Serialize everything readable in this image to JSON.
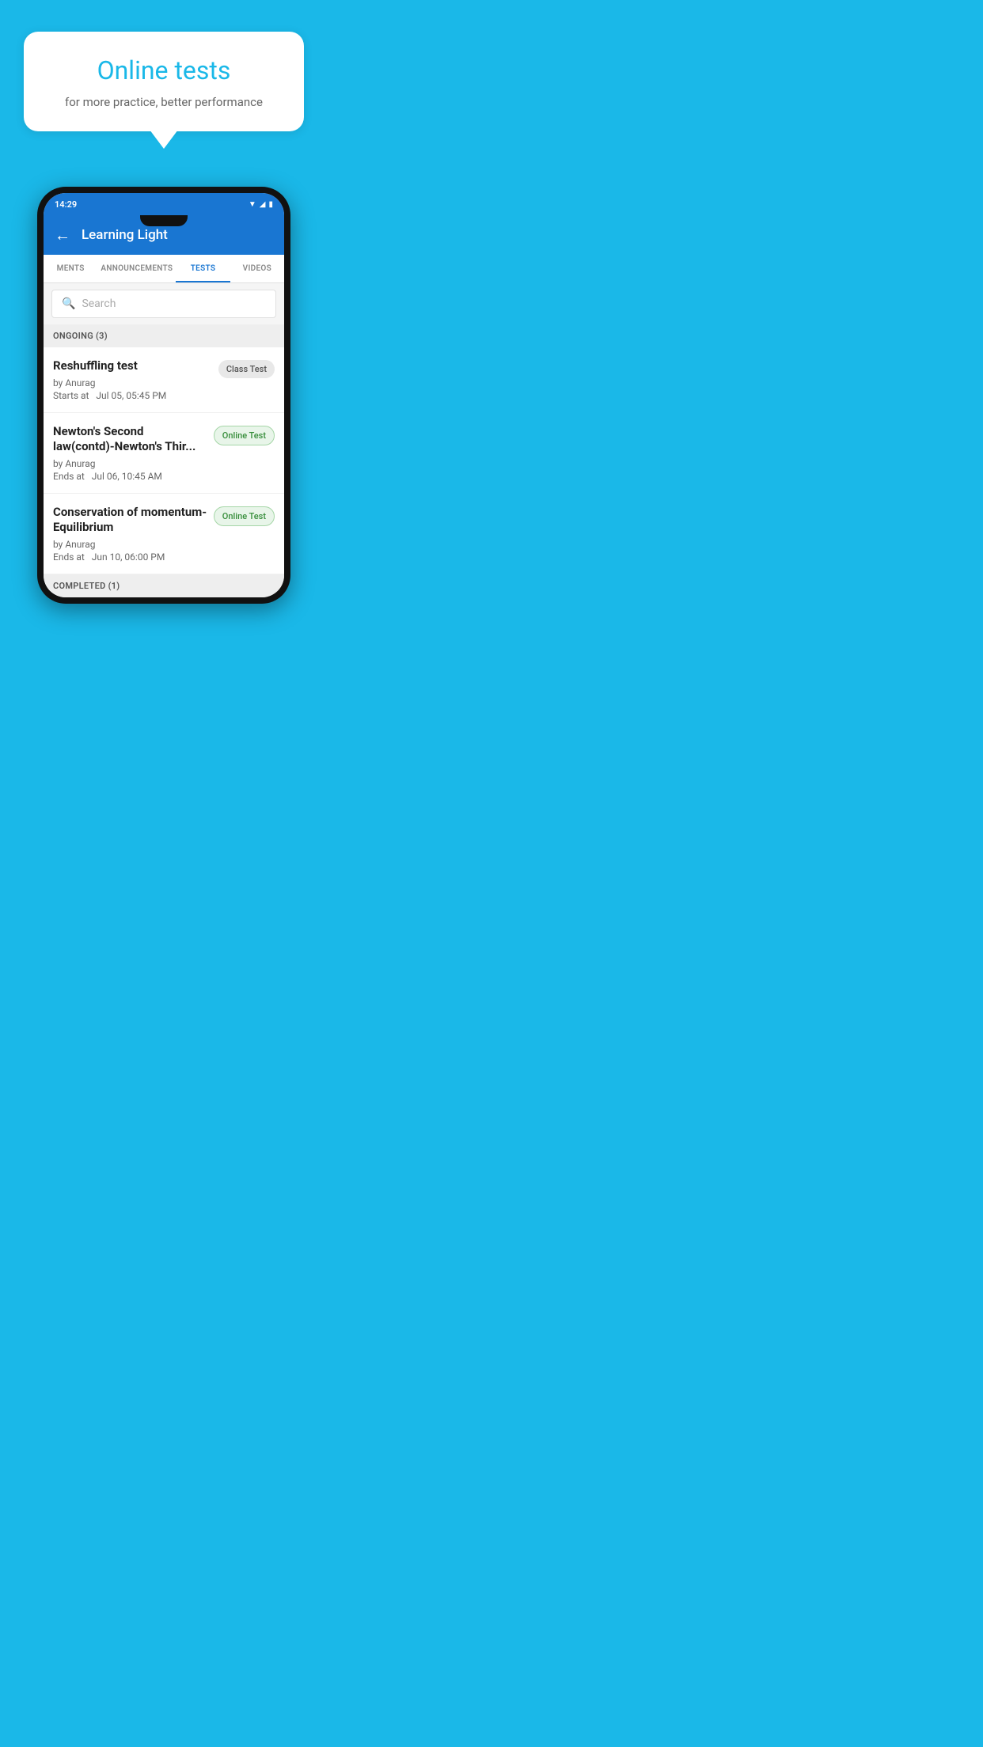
{
  "background_color": "#1ab8e8",
  "hero": {
    "bubble_title": "Online tests",
    "bubble_subtitle": "for more practice, better performance"
  },
  "phone": {
    "status_bar": {
      "time": "14:29",
      "icons": [
        "wifi",
        "signal",
        "battery"
      ]
    },
    "app_bar": {
      "title": "Learning Light",
      "back_label": "←"
    },
    "tabs": [
      {
        "label": "MENTS",
        "active": false
      },
      {
        "label": "ANNOUNCEMENTS",
        "active": false
      },
      {
        "label": "TESTS",
        "active": true
      },
      {
        "label": "VIDEOS",
        "active": false
      }
    ],
    "search": {
      "placeholder": "Search"
    },
    "ongoing_section": {
      "header": "ONGOING (3)",
      "tests": [
        {
          "title": "Reshuffling test",
          "author": "by Anurag",
          "time_label": "Starts at",
          "time": "Jul 05, 05:45 PM",
          "badge": "Class Test",
          "badge_type": "class"
        },
        {
          "title": "Newton's Second law(contd)-Newton's Thir...",
          "author": "by Anurag",
          "time_label": "Ends at",
          "time": "Jul 06, 10:45 AM",
          "badge": "Online Test",
          "badge_type": "online"
        },
        {
          "title": "Conservation of momentum-Equilibrium",
          "author": "by Anurag",
          "time_label": "Ends at",
          "time": "Jun 10, 06:00 PM",
          "badge": "Online Test",
          "badge_type": "online"
        }
      ]
    },
    "completed_section": {
      "header": "COMPLETED (1)"
    }
  }
}
